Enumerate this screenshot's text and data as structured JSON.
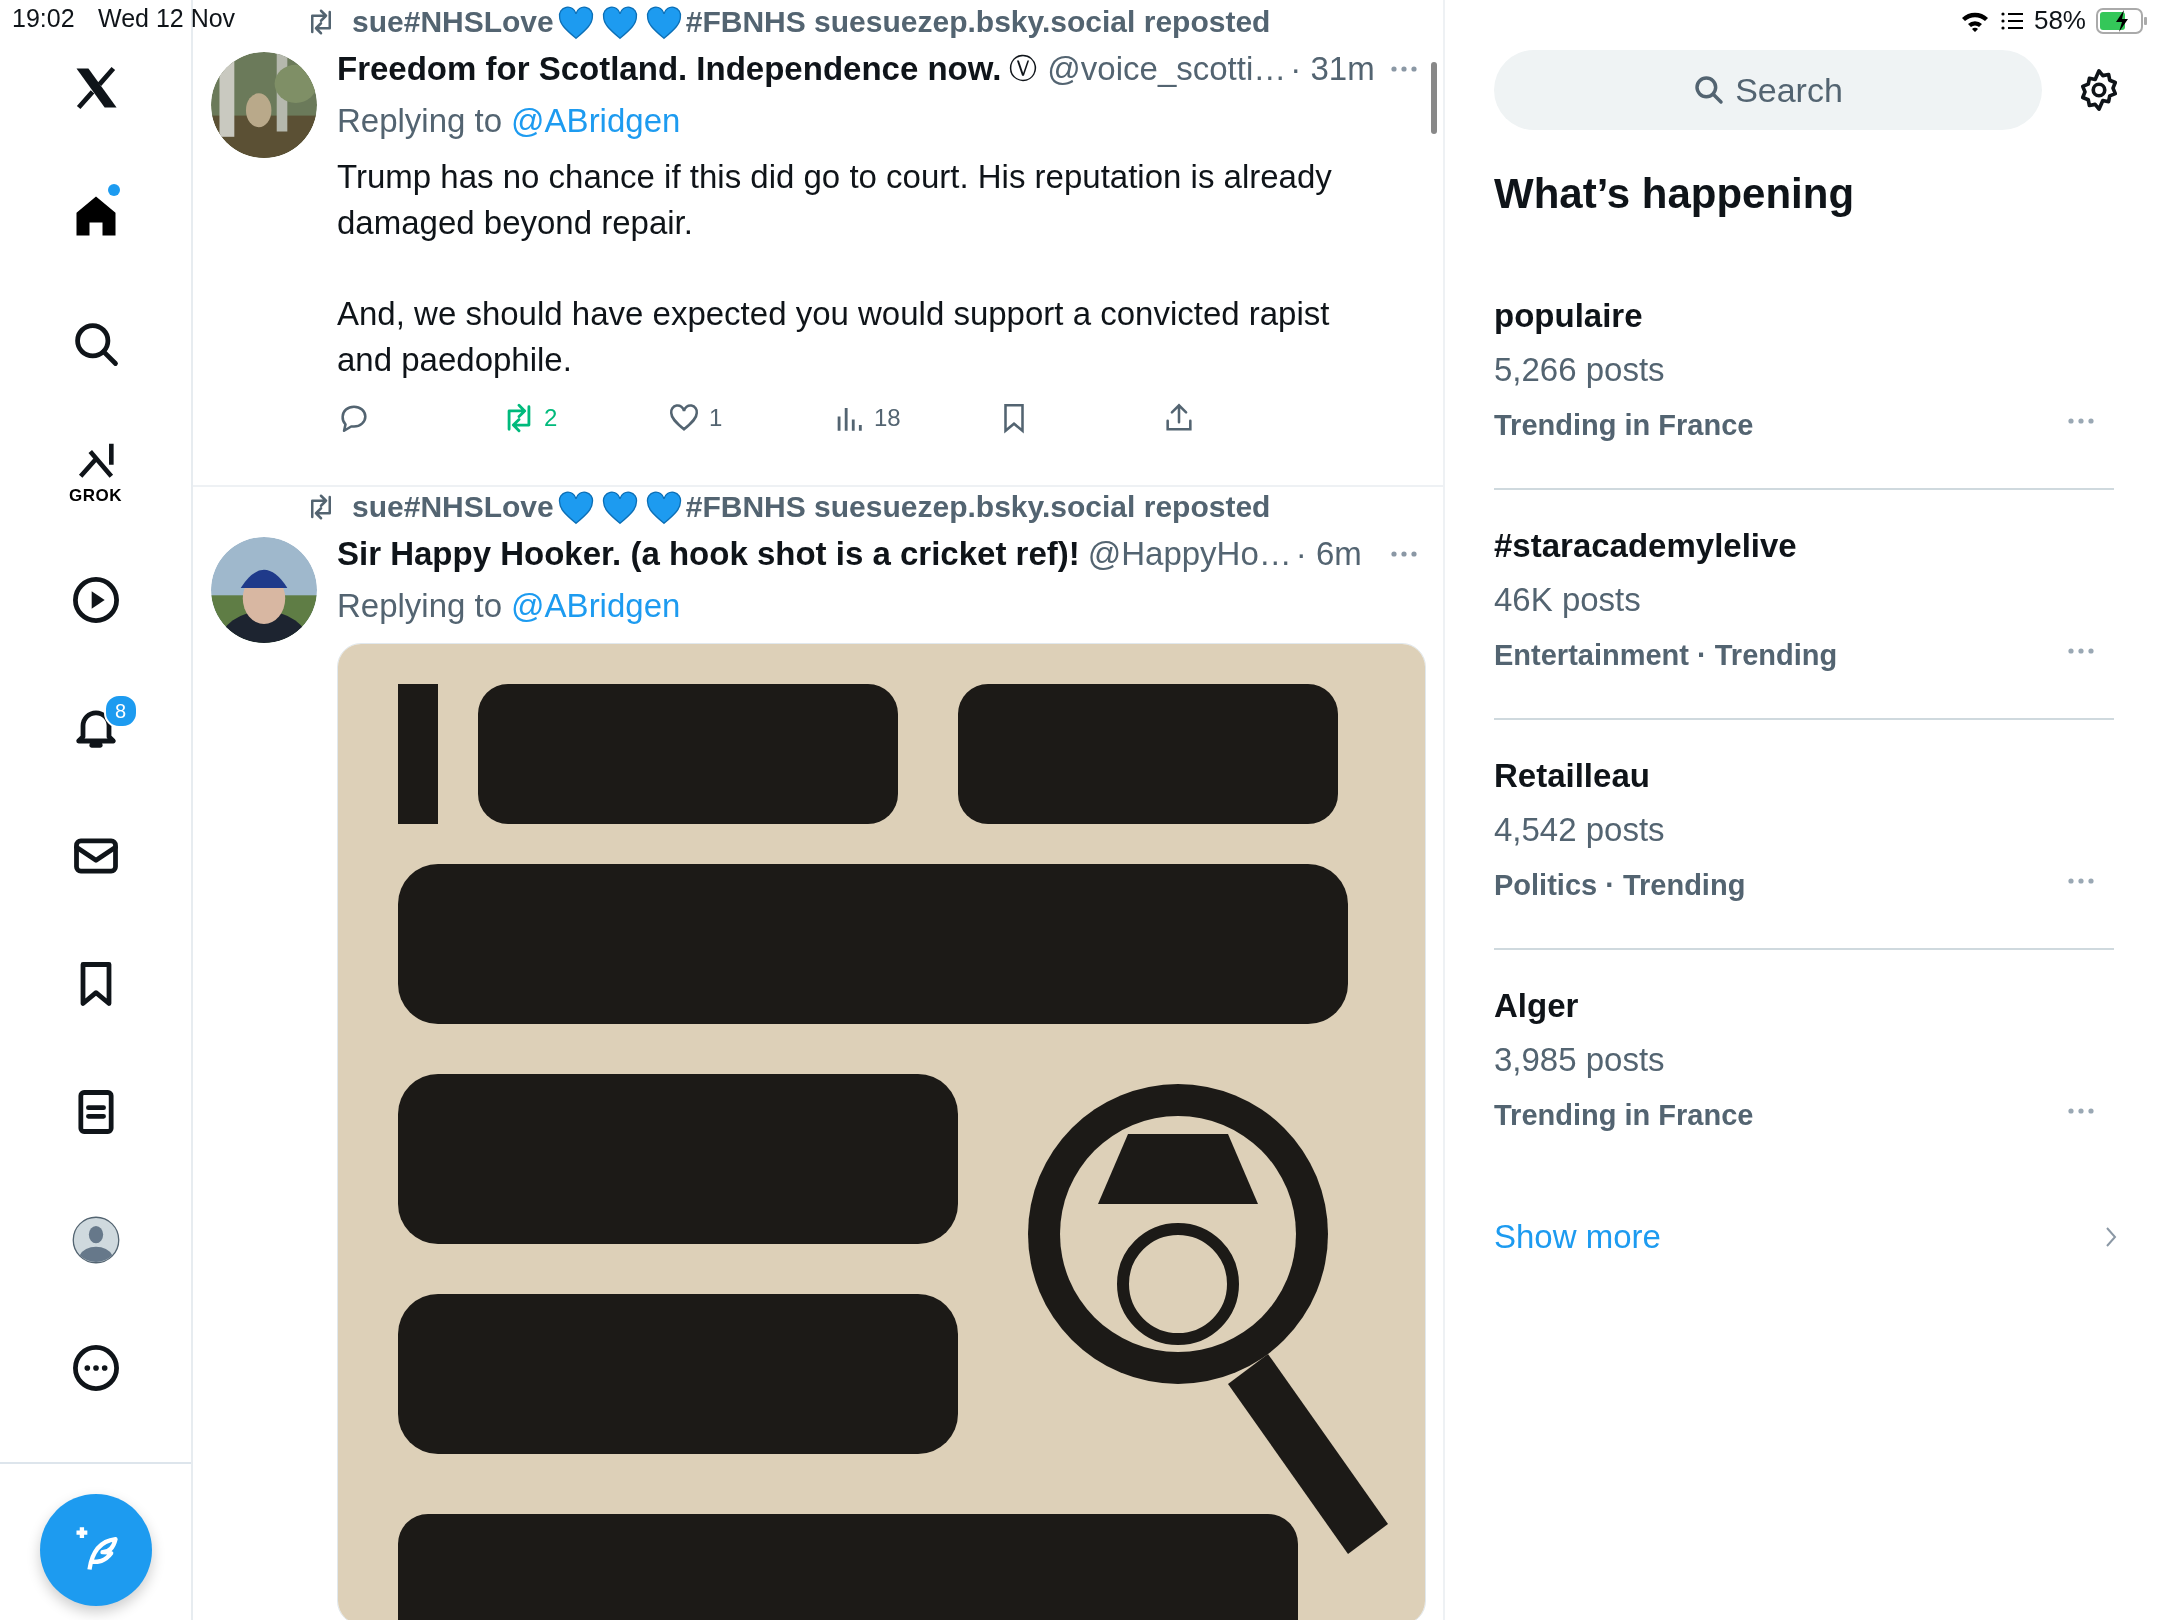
{
  "status_bar": {
    "time": "19:02",
    "date": "Wed 12 Nov",
    "battery": "58%"
  },
  "nav": {
    "items": [
      {
        "kind": "logo",
        "selected": false
      },
      {
        "kind": "home",
        "selected": true,
        "new_dot": true
      },
      {
        "kind": "search",
        "selected": false
      },
      {
        "kind": "grok",
        "label": "GROK",
        "selected": false
      },
      {
        "kind": "video",
        "selected": false
      },
      {
        "kind": "notifications",
        "badge": "8",
        "selected": false
      },
      {
        "kind": "messages",
        "selected": false
      },
      {
        "kind": "bookmarks",
        "selected": false
      },
      {
        "kind": "lists",
        "selected": false
      },
      {
        "kind": "profile",
        "selected": false
      },
      {
        "kind": "more",
        "selected": false
      }
    ]
  },
  "posts": [
    {
      "repost_by": [
        "sue#NHSLove",
        "#FBNHS suesuezep.bsky.social reposted"
      ],
      "name": "Freedom for Scotland. Independence now.",
      "verified_mark": "Ⓥ",
      "handle": "@voice_scotti…",
      "time": "· 31m",
      "replying_prefix": "Replying to",
      "replying_to": "@ABridgen",
      "body": [
        "Trump has no chance if this did go to court. His reputation is already damaged beyond repair.",
        "And, we should have expected you would support a convicted rapist and paedophile."
      ],
      "actions": [
        {
          "kind": "reply",
          "active": false
        },
        {
          "kind": "repost",
          "count": "2",
          "active": true
        },
        {
          "kind": "like",
          "count": "1",
          "active": false
        },
        {
          "kind": "views",
          "count": "18",
          "active": false
        },
        {
          "kind": "bookmark",
          "active": false
        },
        {
          "kind": "share",
          "active": false
        }
      ]
    },
    {
      "repost_by": [
        "sue#NHSLove",
        "#FBNHS suesuezep.bsky.social reposted"
      ],
      "name": "Sir Happy Hooker. (a hook shot is a cricket ref)!",
      "handle": "@HappyHo…",
      "time": "· 6m",
      "replying_prefix": "Replying to",
      "replying_to": "@ABridgen"
    }
  ],
  "sidebar": {
    "search": {
      "placeholder": "Search"
    },
    "heading": "What’s happening",
    "trends": [
      {
        "title": "populaire",
        "posts": "5,266 posts",
        "category": "Trending in France"
      },
      {
        "title": "#staracademylelive",
        "posts": "46K posts",
        "category": "Entertainment · Trending"
      },
      {
        "title": "Retailleau",
        "posts": "4,542 posts",
        "category": "Politics · Trending"
      },
      {
        "title": "Alger",
        "posts": "3,985 posts",
        "category": "Trending in France"
      }
    ],
    "show_more": "Show more"
  }
}
